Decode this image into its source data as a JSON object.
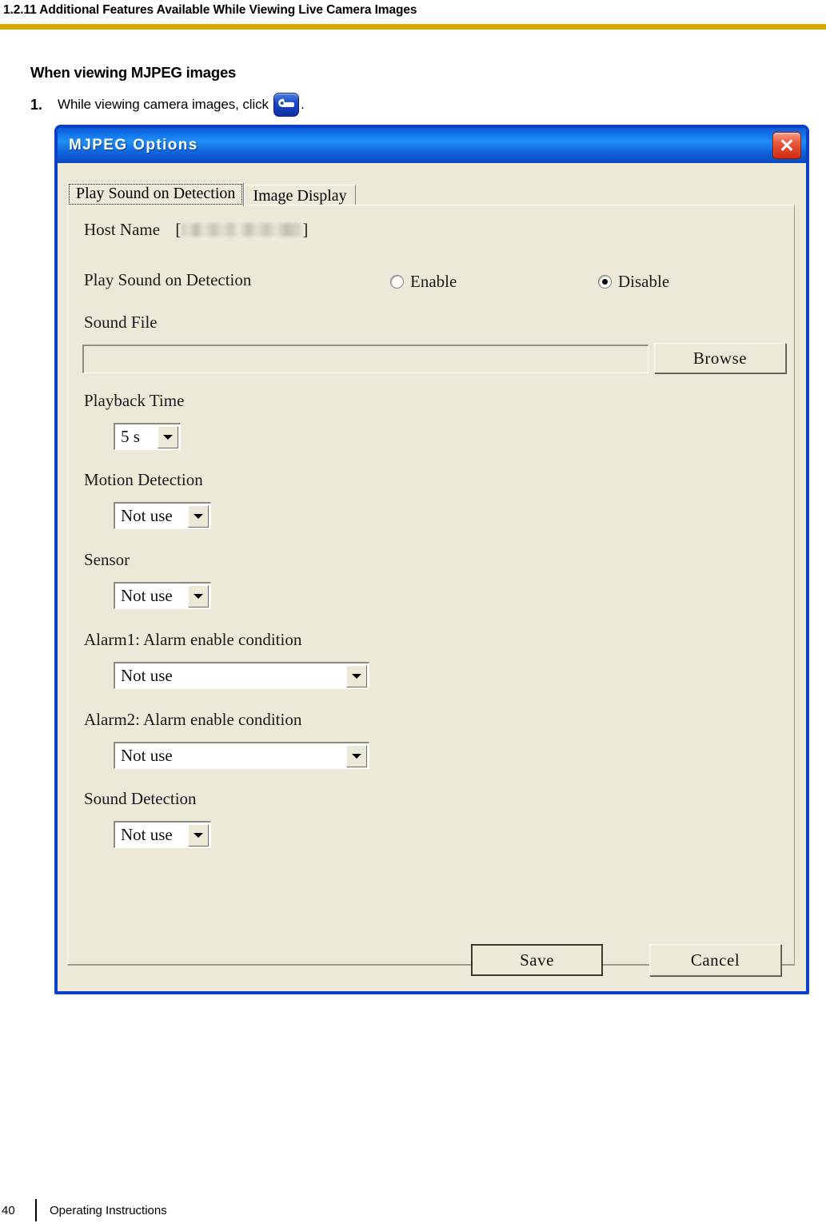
{
  "page": {
    "header_title": "1.2.11 Additional Features Available While Viewing Live Camera Images",
    "rule_color": "#d8a800",
    "section_title": "When viewing MJPEG images",
    "step_number": "1.",
    "step_text": "While viewing camera images, click",
    "step_icon": "wrench-icon",
    "step_period": "."
  },
  "footer": {
    "page_number": "40",
    "label": "Operating Instructions"
  },
  "dialog": {
    "title": "MJPEG Options",
    "titlebar_color": "#0f6fe8",
    "border_color": "#0b3fc8",
    "face_color": "#ece9d8",
    "close_icon": "close-icon",
    "close_glyph": "✕",
    "tabs": [
      {
        "label": "Play Sound on Detection",
        "active": true
      },
      {
        "label": "Image Display",
        "active": false
      }
    ],
    "fields": {
      "host_name": {
        "label": "Host Name",
        "bracket_open": "[",
        "bracket_close": "]",
        "value": ""
      },
      "play_sound": {
        "label": "Play Sound on Detection",
        "options": [
          {
            "label": "Enable",
            "selected": false
          },
          {
            "label": "Disable",
            "selected": true
          }
        ]
      },
      "sound_file": {
        "label": "Sound File",
        "value": "",
        "placeholder": "",
        "browse_label": "Browse"
      },
      "playback_time": {
        "label": "Playback Time",
        "value": "5 s"
      },
      "motion_detection": {
        "label": "Motion Detection",
        "value": "Not use"
      },
      "sensor": {
        "label": "Sensor",
        "value": "Not use"
      },
      "alarm1": {
        "label": "Alarm1: Alarm enable condition",
        "value": "Not use"
      },
      "alarm2": {
        "label": "Alarm2: Alarm enable condition",
        "value": "Not use"
      },
      "sound_detection": {
        "label": "Sound Detection",
        "value": "Not use"
      }
    },
    "buttons": {
      "save": "Save",
      "cancel": "Cancel"
    }
  }
}
